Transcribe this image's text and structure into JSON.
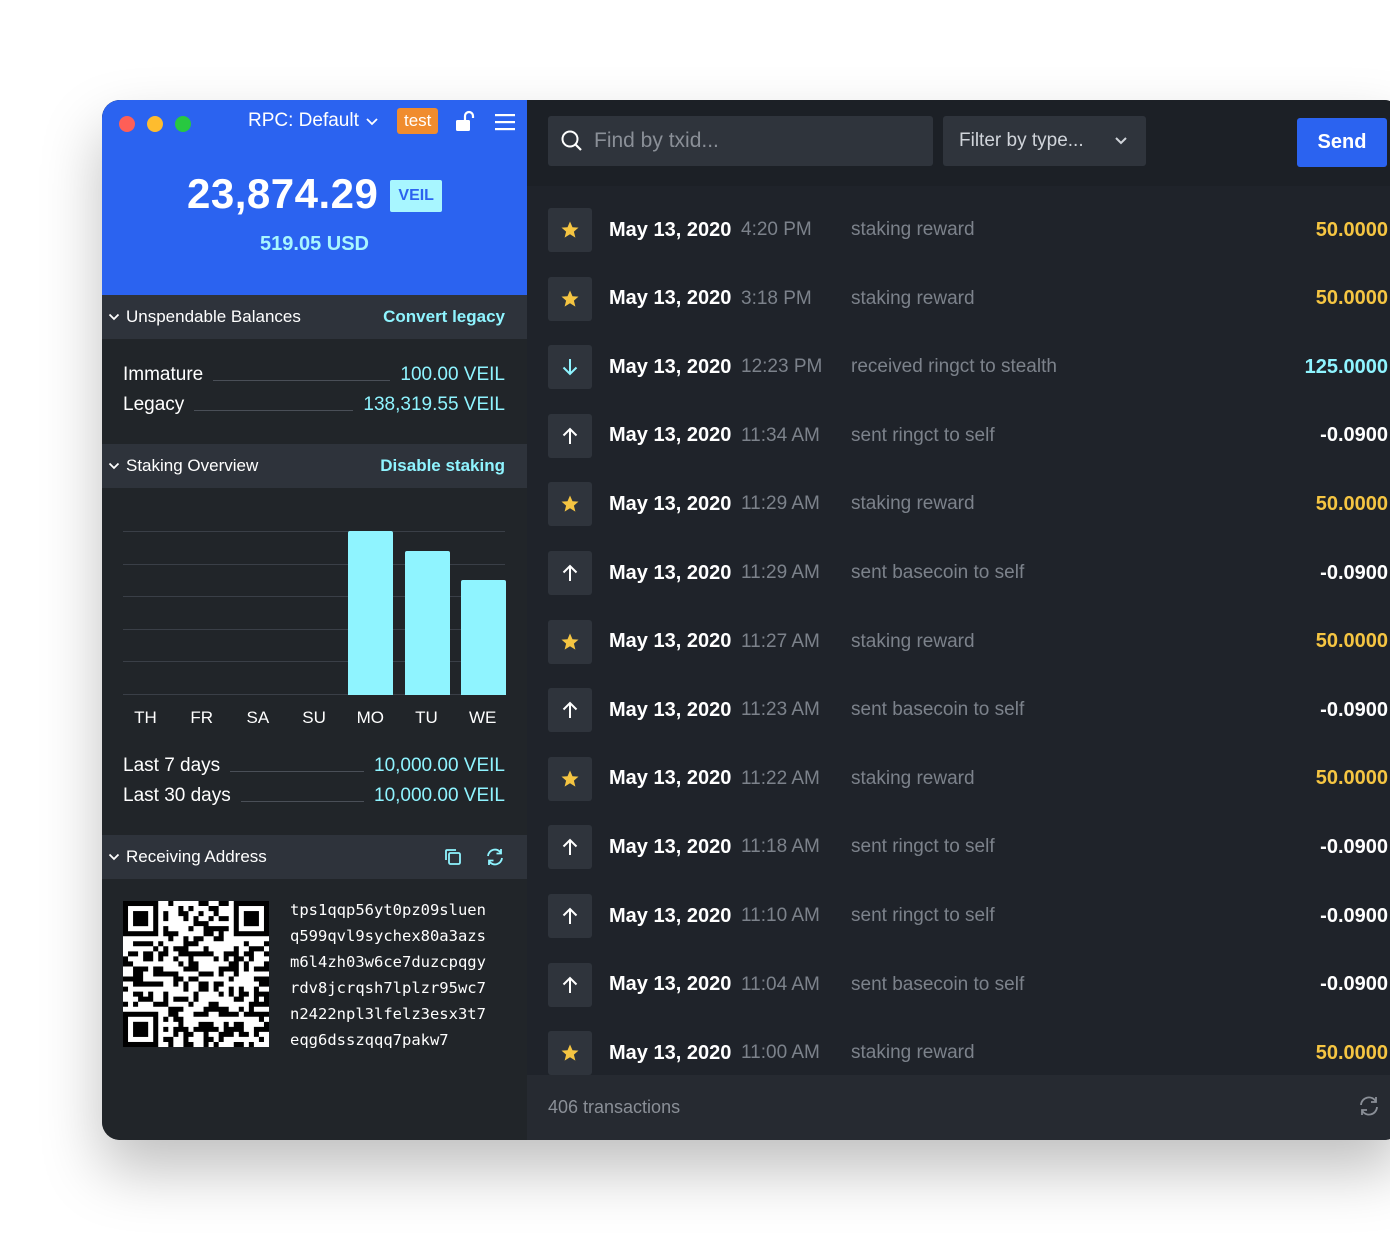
{
  "header": {
    "rpc_label": "RPC: Default",
    "network_badge": "test",
    "lock_icon": "unlock-icon",
    "menu_icon": "hamburger-icon"
  },
  "balance": {
    "amount": "23,874.29",
    "currency": "VEIL",
    "usd": "519.05 USD"
  },
  "unspendable": {
    "title": "Unspendable Balances",
    "action": "Convert legacy",
    "items": [
      {
        "label": "Immature",
        "value": "100.00 VEIL"
      },
      {
        "label": "Legacy",
        "value": "138,319.55 VEIL"
      }
    ]
  },
  "staking": {
    "title": "Staking Overview",
    "action": "Disable staking",
    "summary": [
      {
        "label": "Last 7 days",
        "value": "10,000.00 VEIL"
      },
      {
        "label": "Last 30 days",
        "value": "10,000.00 VEIL"
      }
    ]
  },
  "chart_data": {
    "type": "bar",
    "categories": [
      "TH",
      "FR",
      "SA",
      "SU",
      "MO",
      "TU",
      "WE"
    ],
    "values": [
      0,
      0,
      0,
      0,
      100,
      88,
      70
    ],
    "ylim": [
      0,
      100
    ],
    "grid": true,
    "color": "#8ff4ff"
  },
  "receiving": {
    "title": "Receiving Address",
    "address_lines": [
      "tps1qqp56yt0pz09sluen",
      "q599qvl9sychex80a3azs",
      "m6l4zh03w6ce7duzcpqgy",
      "rdv8jcrqsh7lplzr95wc7",
      "n2422npl3lfelz3esx3t7",
      "eqg6dsszqqq7pakw7"
    ]
  },
  "toolbar": {
    "search_placeholder": "Find by txid...",
    "filter_label": "Filter by type...",
    "send_label": "Send"
  },
  "transactions": [
    {
      "icon": "star-icon",
      "date": "May 13, 2020",
      "time": "4:20 PM",
      "desc": "staking reward",
      "amount": "50.0000",
      "kind": "stake"
    },
    {
      "icon": "star-icon",
      "date": "May 13, 2020",
      "time": "3:18 PM",
      "desc": "staking reward",
      "amount": "50.0000",
      "kind": "stake"
    },
    {
      "icon": "arrow-down-icon",
      "date": "May 13, 2020",
      "time": "12:23 PM",
      "desc": "received ringct to stealth",
      "amount": "125.0000",
      "kind": "in"
    },
    {
      "icon": "arrow-up-icon",
      "date": "May 13, 2020",
      "time": "11:34 AM",
      "desc": "sent ringct to self",
      "amount": "-0.0900",
      "kind": "out"
    },
    {
      "icon": "star-icon",
      "date": "May 13, 2020",
      "time": "11:29 AM",
      "desc": "staking reward",
      "amount": "50.0000",
      "kind": "stake"
    },
    {
      "icon": "arrow-up-icon",
      "date": "May 13, 2020",
      "time": "11:29 AM",
      "desc": "sent basecoin to self",
      "amount": "-0.0900",
      "kind": "out"
    },
    {
      "icon": "star-icon",
      "date": "May 13, 2020",
      "time": "11:27 AM",
      "desc": "staking reward",
      "amount": "50.0000",
      "kind": "stake"
    },
    {
      "icon": "arrow-up-icon",
      "date": "May 13, 2020",
      "time": "11:23 AM",
      "desc": "sent basecoin to self",
      "amount": "-0.0900",
      "kind": "out"
    },
    {
      "icon": "star-icon",
      "date": "May 13, 2020",
      "time": "11:22 AM",
      "desc": "staking reward",
      "amount": "50.0000",
      "kind": "stake"
    },
    {
      "icon": "arrow-up-icon",
      "date": "May 13, 2020",
      "time": "11:18 AM",
      "desc": "sent ringct to self",
      "amount": "-0.0900",
      "kind": "out"
    },
    {
      "icon": "arrow-up-icon",
      "date": "May 13, 2020",
      "time": "11:10 AM",
      "desc": "sent ringct to self",
      "amount": "-0.0900",
      "kind": "out"
    },
    {
      "icon": "arrow-up-icon",
      "date": "May 13, 2020",
      "time": "11:04 AM",
      "desc": "sent basecoin to self",
      "amount": "-0.0900",
      "kind": "out"
    },
    {
      "icon": "star-icon",
      "date": "May 13, 2020",
      "time": "11:00 AM",
      "desc": "staking reward",
      "amount": "50.0000",
      "kind": "stake"
    }
  ],
  "footer": {
    "count": "406 transactions"
  },
  "colors": {
    "accent": "#2b63f0",
    "cyan": "#8ff4ff",
    "stake": "#f5c542",
    "test_badge": "#f08c2e"
  }
}
